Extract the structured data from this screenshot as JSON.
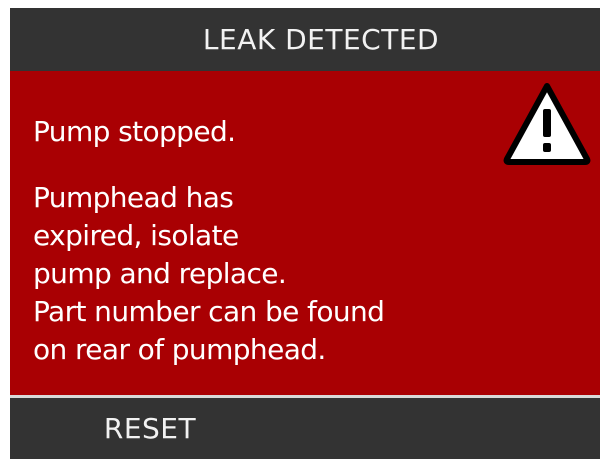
{
  "header": {
    "title": "LEAK DETECTED"
  },
  "alert": {
    "status": "Pump stopped.",
    "lines": [
      "Pumphead has",
      "expired, isolate",
      "pump and replace.",
      "Part number can be found",
      "on rear of pumphead."
    ],
    "icon": "warning-triangle-icon",
    "background_color": "#a90003"
  },
  "footer": {
    "reset_label": "RESET"
  }
}
